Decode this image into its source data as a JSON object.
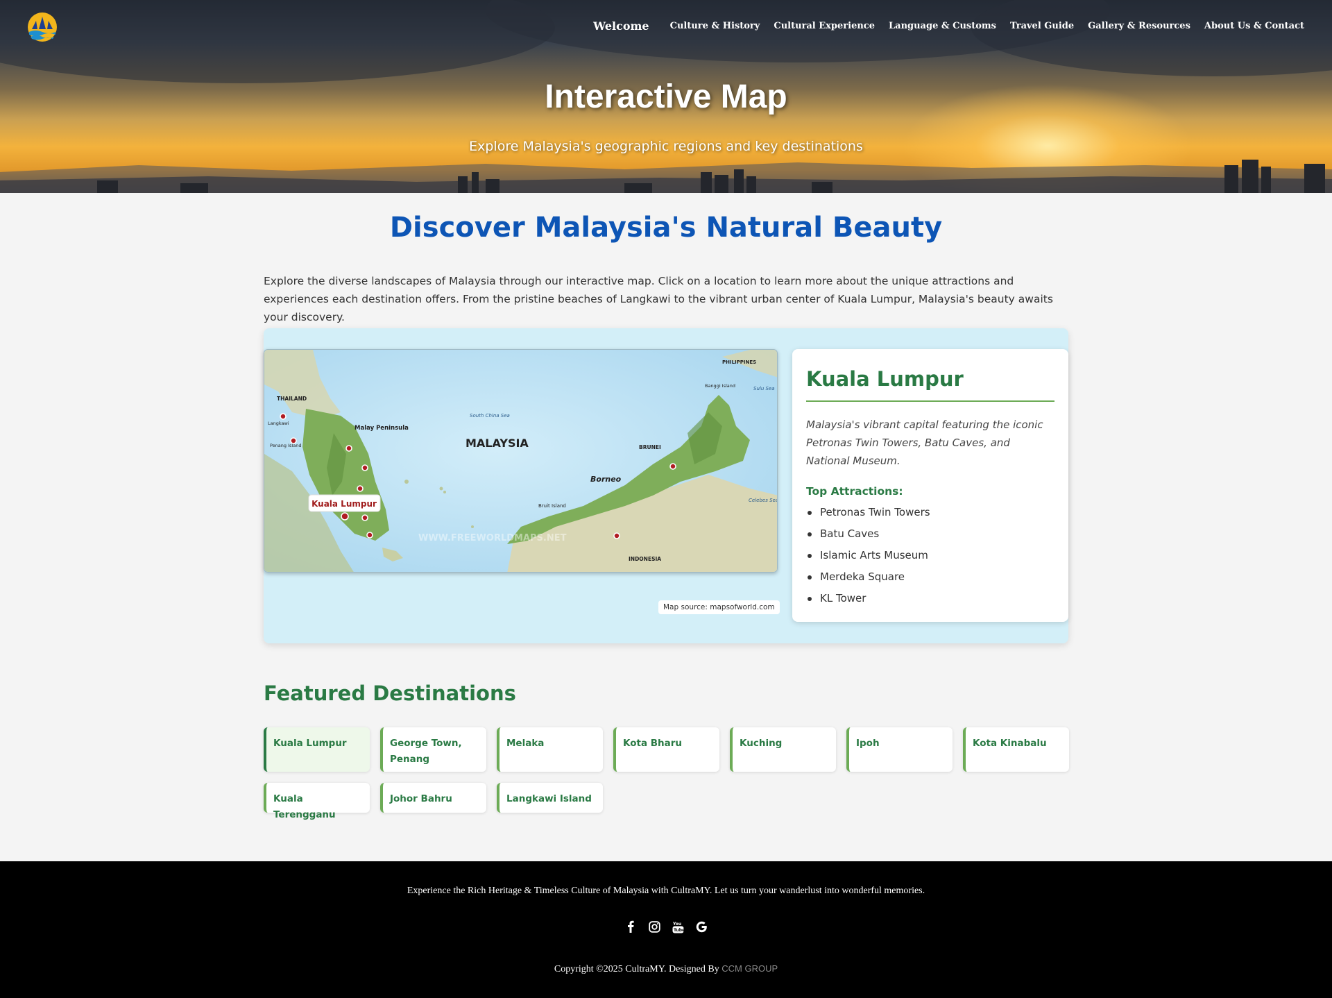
{
  "nav": {
    "welcome": "Welcome",
    "items": [
      "Culture & History",
      "Cultural Experience",
      "Language & Customs",
      "Travel Guide",
      "Gallery & Resources",
      "About Us & Contact"
    ]
  },
  "hero": {
    "title": "Interactive Map",
    "subtitle": "Explore Malaysia's geographic regions and key destinations"
  },
  "main": {
    "title": "Discover Malaysia's Natural Beauty",
    "intro": "Explore the diverse landscapes of Malaysia through our interactive map. Click on a location to learn more about the unique attractions and experiences each destination offers. From the pristine beaches of Langkawi to the vibrant urban center of Kuala Lumpur, Malaysia's beauty awaits your discovery."
  },
  "map": {
    "tooltip": "Kuala Lumpur",
    "source": "Map source: mapsofworld.com",
    "labels": {
      "thailand": "THAILAND",
      "langkawi": "Langkawi",
      "penang": "Penang Island",
      "malay_peninsula": "Malay Peninsula",
      "malaysia": "MALAYSIA",
      "south_china_sea": "South China Sea",
      "brunei": "BRUNEI",
      "borneo": "Borneo",
      "bruit": "Bruit Island",
      "indonesia": "INDONESIA",
      "philippines": "PHILIPPINES",
      "banggi": "Banggi Island",
      "sulu": "Sulu Sea",
      "celebes": "Celebes Sea",
      "watermark": "WWW.FREEWORLDMAPS.NET"
    }
  },
  "info": {
    "name": "Kuala Lumpur",
    "description": "Malaysia's vibrant capital featuring the iconic Petronas Twin Towers, Batu Caves, and National Museum.",
    "attractions_title": "Top Attractions:",
    "attractions": [
      "Petronas Twin Towers",
      "Batu Caves",
      "Islamic Arts Museum",
      "Merdeka Square",
      "KL Tower"
    ]
  },
  "featured": {
    "title": "Featured Destinations",
    "items": [
      "Kuala Lumpur",
      "George Town, Penang",
      "Melaka",
      "Kota Bharu",
      "Kuching",
      "Ipoh",
      "Kota Kinabalu",
      "Kuala Terengganu",
      "Johor Bahru",
      "Langkawi Island"
    ]
  },
  "footer": {
    "tagline": "Experience the Rich Heritage & Timeless Culture of Malaysia with CultraMY. Let us turn your wanderlust into wonderful memories.",
    "copyright": "Copyright ©2025 CultraMY. Designed By",
    "designer": "CCM GROUP",
    "icons": [
      "facebook-icon",
      "instagram-icon",
      "youtube-icon",
      "google-icon"
    ]
  },
  "colors": {
    "accent_blue": "#0d55b5",
    "accent_green": "#2a7a44",
    "border_green": "#6cab56",
    "map_panel_bg": "#d3eff8",
    "marker_red": "#b01c22"
  }
}
